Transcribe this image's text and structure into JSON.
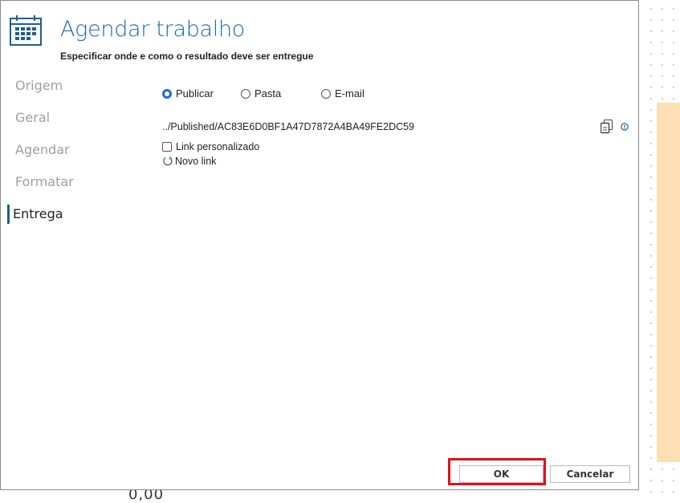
{
  "dialog": {
    "title": "Agendar trabalho",
    "subtitle": "Especificar onde e como o resultado deve ser entregue",
    "header_icon": "calendar-icon"
  },
  "nav": {
    "items": [
      {
        "label": "Origem",
        "active": false
      },
      {
        "label": "Geral",
        "active": false
      },
      {
        "label": "Agendar",
        "active": false
      },
      {
        "label": "Formatar",
        "active": false
      },
      {
        "label": "Entrega",
        "active": true
      }
    ]
  },
  "delivery": {
    "options": [
      {
        "label": "Publicar",
        "checked": true
      },
      {
        "label": "Pasta",
        "checked": false
      },
      {
        "label": "E-mail",
        "checked": false
      }
    ],
    "path": "../Published/AC83E6D0BF1A47D7872A4BA49FE2DC59",
    "custom_link_label": "Link personalizado",
    "custom_link_checked": false,
    "new_link_label": "Novo link"
  },
  "buttons": {
    "ok": "OK",
    "cancel": "Cancelar"
  },
  "background": {
    "partial_text": "0,00"
  },
  "colors": {
    "accent": "#1e6aa8",
    "highlight": "#e0101a",
    "side_panel": "#fde0b4"
  }
}
